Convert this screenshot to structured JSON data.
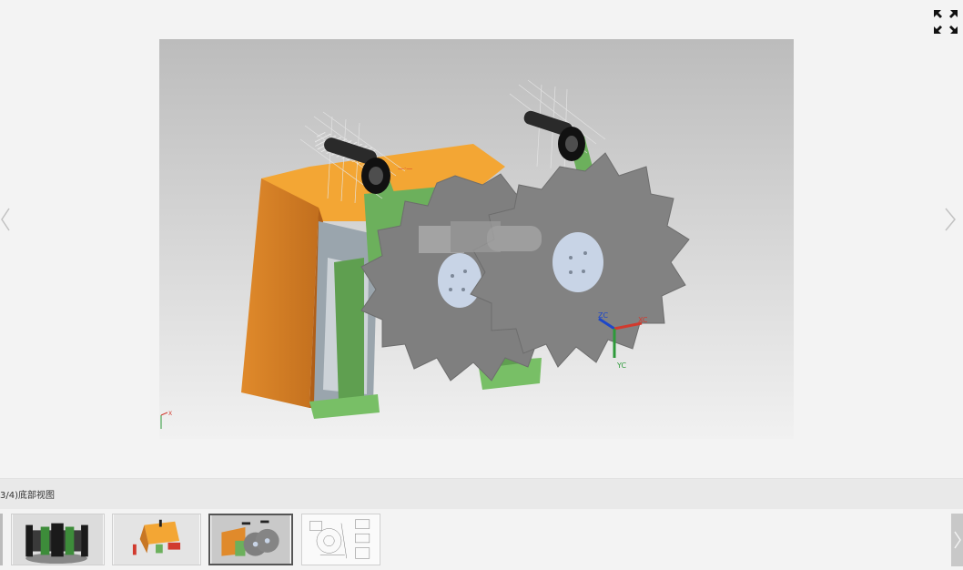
{
  "viewer": {
    "fullscreen_icon": "expand-arrows-icon",
    "prev_icon": "chevron-left-icon",
    "next_icon": "chevron-right-icon",
    "axis_labels": {
      "zc": "ZC",
      "xc": "XC",
      "yc": "YC",
      "corner_x": "X"
    }
  },
  "caption": {
    "text": "3/4)底部视图"
  },
  "thumbnails": [
    {
      "name": "thumbnail-1",
      "selected": false
    },
    {
      "name": "thumbnail-2",
      "selected": false
    },
    {
      "name": "thumbnail-3",
      "selected": true
    },
    {
      "name": "thumbnail-4",
      "selected": false
    }
  ],
  "colors": {
    "orange_body": "#f0a235",
    "orange_side": "#d77f25",
    "green_parts": "#6cae5a",
    "grey_disc": "#7d7d7d",
    "hub": "#c8d4e6",
    "bg_top": "#bdbdbd",
    "bg_bottom": "#f2f2f2"
  }
}
